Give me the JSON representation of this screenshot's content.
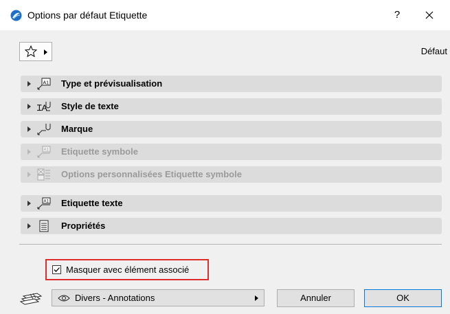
{
  "window": {
    "title": "Options par défaut Etiquette",
    "help_label": "?"
  },
  "favorites": {
    "preset_label": "Défaut"
  },
  "panels": [
    {
      "label": "Type et prévisualisation",
      "icon": "label-type-icon",
      "enabled": true
    },
    {
      "label": "Style de texte",
      "icon": "text-style-icon",
      "enabled": true
    },
    {
      "label": "Marque",
      "icon": "marker-icon",
      "enabled": true
    },
    {
      "label": "Etiquette symbole",
      "icon": "symbol-label-icon",
      "enabled": false
    },
    {
      "label": "Options personnalisées Etiquette symbole",
      "icon": "custom-options-icon",
      "enabled": false
    },
    {
      "label": "Etiquette texte",
      "icon": "text-label-icon",
      "enabled": true
    },
    {
      "label": "Propriétés",
      "icon": "properties-icon",
      "enabled": true
    }
  ],
  "hide_with_element": {
    "label": "Masquer avec élément associé",
    "checked": true
  },
  "layer": {
    "value": "Divers - Annotations"
  },
  "buttons": {
    "cancel": "Annuler",
    "ok": "OK"
  },
  "colors": {
    "highlight_border": "#e02b2b",
    "default_button_border": "#0078d7",
    "panel_bg": "#dcdcdc",
    "disabled_text": "#9a9a9a"
  }
}
